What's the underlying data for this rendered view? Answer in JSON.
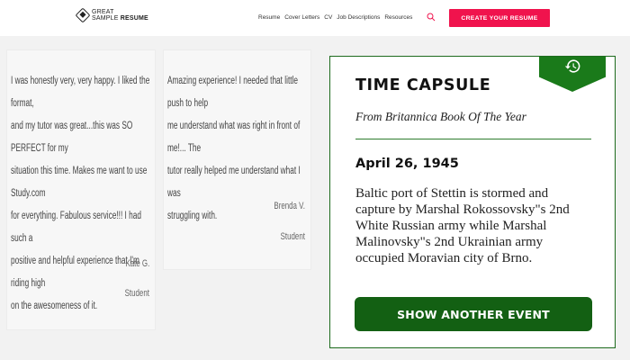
{
  "header": {
    "logo": {
      "line1": "GREAT",
      "line2_a": "SAMPLE",
      "line2_b": "RESUME"
    },
    "nav": [
      "Resume",
      "Cover Letters",
      "CV",
      "Job Descriptions",
      "Resources"
    ],
    "cta_label": "CREATE YOUR RESUME",
    "colors": {
      "cta": "#f0134d"
    }
  },
  "testimonials": [
    {
      "lines": [
        "I was honestly very, very happy. I liked the format,",
        "and my tutor was great...this was SO PERFECT for my",
        "situation this time. Makes me want to use Study.com",
        "for everything. Fabulous service!!! I had such a",
        "positive and helpful experience that I'm riding high",
        "on the awesomeness of it."
      ],
      "author": "Kate G.",
      "role": "Student"
    },
    {
      "lines": [
        "Amazing experience! I needed that little push to help",
        "me understand what was right in front of me!... The",
        "tutor really helped me understand what I was",
        "struggling with."
      ],
      "author": "Brenda V.",
      "role": "Student"
    }
  ],
  "time_capsule": {
    "icon": "history-icon",
    "title": "TIME CAPSULE",
    "subtitle": "From Britannica Book Of The Year",
    "date": "April 26, 1945",
    "event": "Baltic port of Stettin is stormed and capture by Marshal Rokossovsky\"s 2nd White Russian army while Marshal Malinovsky\"s 2nd Ukrainian army occupied Moravian city of Brno.",
    "button_label": "SHOW ANOTHER EVENT",
    "colors": {
      "accent": "#1a7a1a",
      "button": "#136013"
    }
  }
}
